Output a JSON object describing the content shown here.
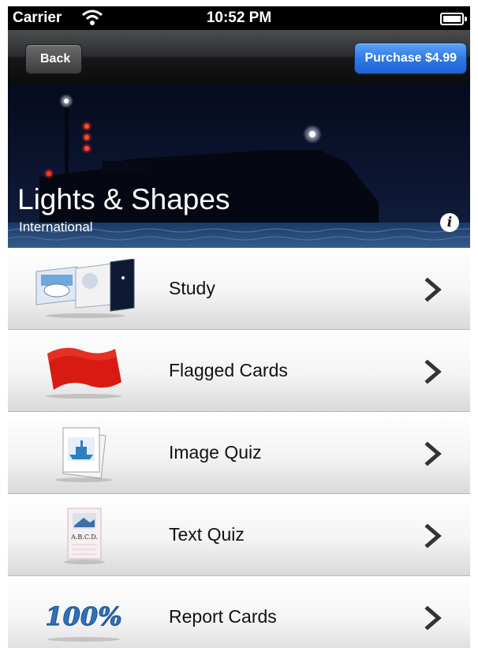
{
  "status_bar": {
    "carrier": "Carrier",
    "time": "10:52 PM"
  },
  "nav": {
    "back_label": "Back",
    "purchase_label": "Purchase $4.99"
  },
  "hero": {
    "title": "Lights & Shapes",
    "subtitle": "International"
  },
  "menu": [
    {
      "label": "Study",
      "icon": "study-cards-icon"
    },
    {
      "label": "Flagged Cards",
      "icon": "red-flag-icon"
    },
    {
      "label": "Image Quiz",
      "icon": "image-quiz-icon"
    },
    {
      "label": "Text Quiz",
      "icon": "text-quiz-icon"
    },
    {
      "label": "Report Cards",
      "icon": "percent-icon"
    }
  ],
  "text_quiz_card_text": "A.B.C.D.",
  "report_icon_text": "100%"
}
